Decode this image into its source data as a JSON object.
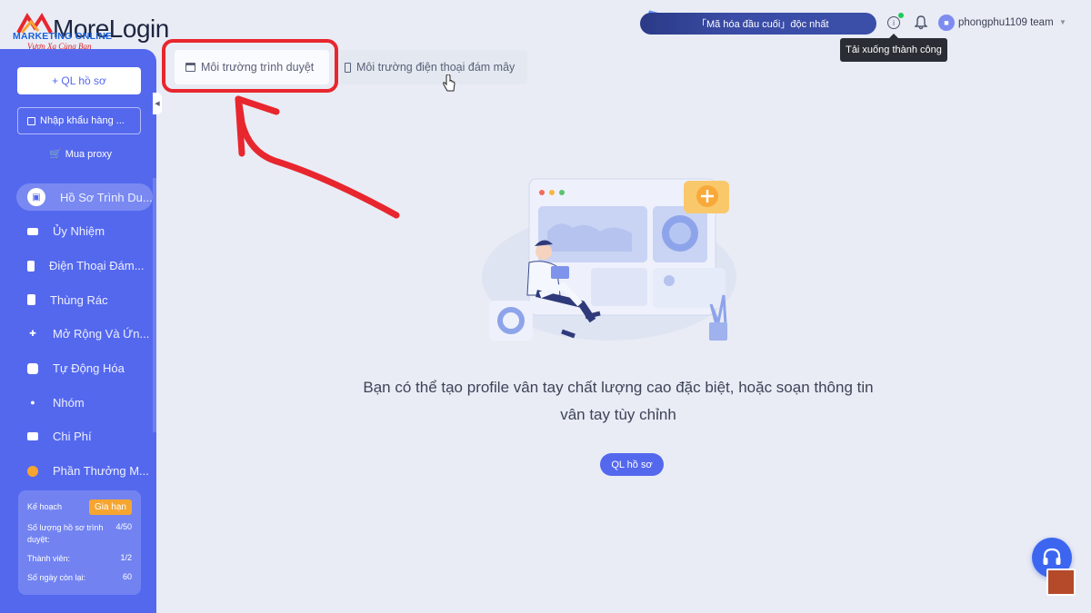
{
  "app": {
    "logo_text": "MoreLogin",
    "watermark_title": "MARKETING ONLINE",
    "watermark_subtitle": "Vươn Xa Cùng Bạn"
  },
  "sidebar": {
    "add_profile_label": "+ QL hồ sơ",
    "import_label": "Nhập khẩu hàng ...",
    "buy_proxy_label": "Mua proxy",
    "items": [
      {
        "label": "Hồ Sơ Trình Du...",
        "icon": "browser-profile-icon",
        "active": true
      },
      {
        "label": "Ủy Nhiệm",
        "icon": "proxy-icon"
      },
      {
        "label": "Điện Thoại Đám...",
        "icon": "phone-icon"
      },
      {
        "label": "Thùng Rác",
        "icon": "trash-icon"
      },
      {
        "label": "Mở Rộng Và Ứn...",
        "icon": "puzzle-icon"
      },
      {
        "label": "Tự Động Hóa",
        "icon": "robot-icon"
      },
      {
        "label": "Nhóm",
        "icon": "group-icon"
      },
      {
        "label": "Chi Phí",
        "icon": "wallet-icon"
      },
      {
        "label": "Phần Thưởng M...",
        "icon": "coin-icon"
      }
    ],
    "plan": {
      "plan_label": "Kế hoạch",
      "renew_label": "Gia hạn",
      "profiles_label": "Số lượng hồ sơ trình duyệt:",
      "profiles_value": "4/50",
      "members_label": "Thành viên:",
      "members_value": "1/2",
      "days_label": "Số ngày còn lại:",
      "days_value": "60"
    }
  },
  "tabs": {
    "browser": "Môi trường trình duyệt",
    "cloud_phone": "Môi trường điện thoại đám mây"
  },
  "header": {
    "promo_text": "「Mã hóa đầu cuối」độc nhất",
    "username": "phongphu1109 team",
    "tooltip": "Tải xuống thành công"
  },
  "empty_state": {
    "line1": "Bạn có thể tạo profile vân tay chất lượng cao đặc biệt, hoặc soạn thông tin",
    "line2": "vân tay tùy chỉnh",
    "button_label": "QL hồ sơ"
  },
  "colors": {
    "sidebar": "#5468ee",
    "highlight": "#e8262e",
    "renew": "#f6a531",
    "online": "#1ec95a"
  }
}
